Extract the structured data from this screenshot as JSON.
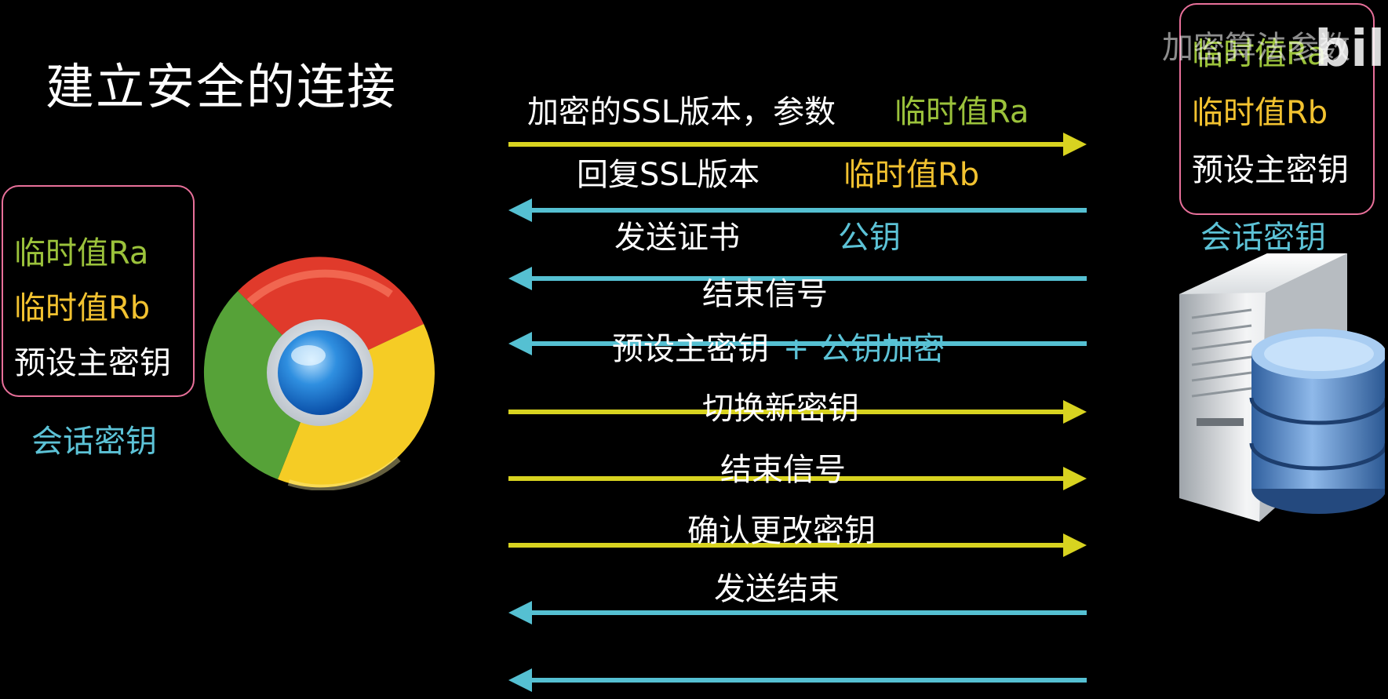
{
  "title": "建立安全的连接",
  "colors": {
    "green": "#9bc23b",
    "yellow": "#f2c230",
    "cyan": "#5cc2d6",
    "arrow_yellow": "#d8d320",
    "arrow_cyan": "#55c0d2",
    "box_border": "#e8709a",
    "white": "#ffffff"
  },
  "client": {
    "icon": "chrome-browser-icon",
    "values": [
      {
        "text": "临时值Ra",
        "color": "#9bc23b"
      },
      {
        "text": "临时值Rb",
        "color": "#f2c230"
      },
      {
        "text": "预设主密钥",
        "color": "#ffffff"
      }
    ],
    "session_key": "会话密钥"
  },
  "server": {
    "icon": "server-database-icon",
    "values": [
      {
        "text": "临时值Ra",
        "color": "#9bc23b"
      },
      {
        "text": "临时值Rb",
        "color": "#f2c230"
      },
      {
        "text": "预设主密钥",
        "color": "#ffffff"
      }
    ],
    "session_key": "会话密钥"
  },
  "watermark": {
    "text": "加密算法参数",
    "logo": "bili"
  },
  "messages": [
    {
      "direction": "to-server",
      "arrow_color": "#d8d320",
      "parts": [
        {
          "text": "加密的SSL版本，参数",
          "color": "#ffffff"
        },
        {
          "text": "临时值Ra",
          "color": "#9bc23b"
        }
      ]
    },
    {
      "direction": "to-client",
      "arrow_color": "#55c0d2",
      "parts": [
        {
          "text": "回复SSL版本",
          "color": "#ffffff"
        },
        {
          "text": "临时值Rb",
          "color": "#f2c230"
        }
      ]
    },
    {
      "direction": "to-client",
      "arrow_color": "#55c0d2",
      "parts": [
        {
          "text": "发送证书",
          "color": "#ffffff"
        },
        {
          "text": "公钥",
          "color": "#5cc2d6"
        }
      ]
    },
    {
      "direction": "to-client",
      "arrow_color": "#55c0d2",
      "parts": [
        {
          "text": "结束信号",
          "color": "#ffffff"
        }
      ]
    },
    {
      "direction": "to-server",
      "arrow_color": "#d8d320",
      "parts": [
        {
          "text": "预设主密钥",
          "color": "#ffffff"
        },
        {
          "text": "+ 公钥加密",
          "color": "#5cc2d6"
        }
      ]
    },
    {
      "direction": "to-server",
      "arrow_color": "#d8d320",
      "parts": [
        {
          "text": "切换新密钥",
          "color": "#ffffff"
        }
      ]
    },
    {
      "direction": "to-server",
      "arrow_color": "#d8d320",
      "parts": [
        {
          "text": "结束信号",
          "color": "#ffffff"
        }
      ]
    },
    {
      "direction": "to-client",
      "arrow_color": "#55c0d2",
      "parts": [
        {
          "text": "确认更改密钥",
          "color": "#ffffff"
        }
      ]
    },
    {
      "direction": "to-client",
      "arrow_color": "#55c0d2",
      "parts": [
        {
          "text": "发送结束",
          "color": "#ffffff"
        }
      ]
    }
  ]
}
